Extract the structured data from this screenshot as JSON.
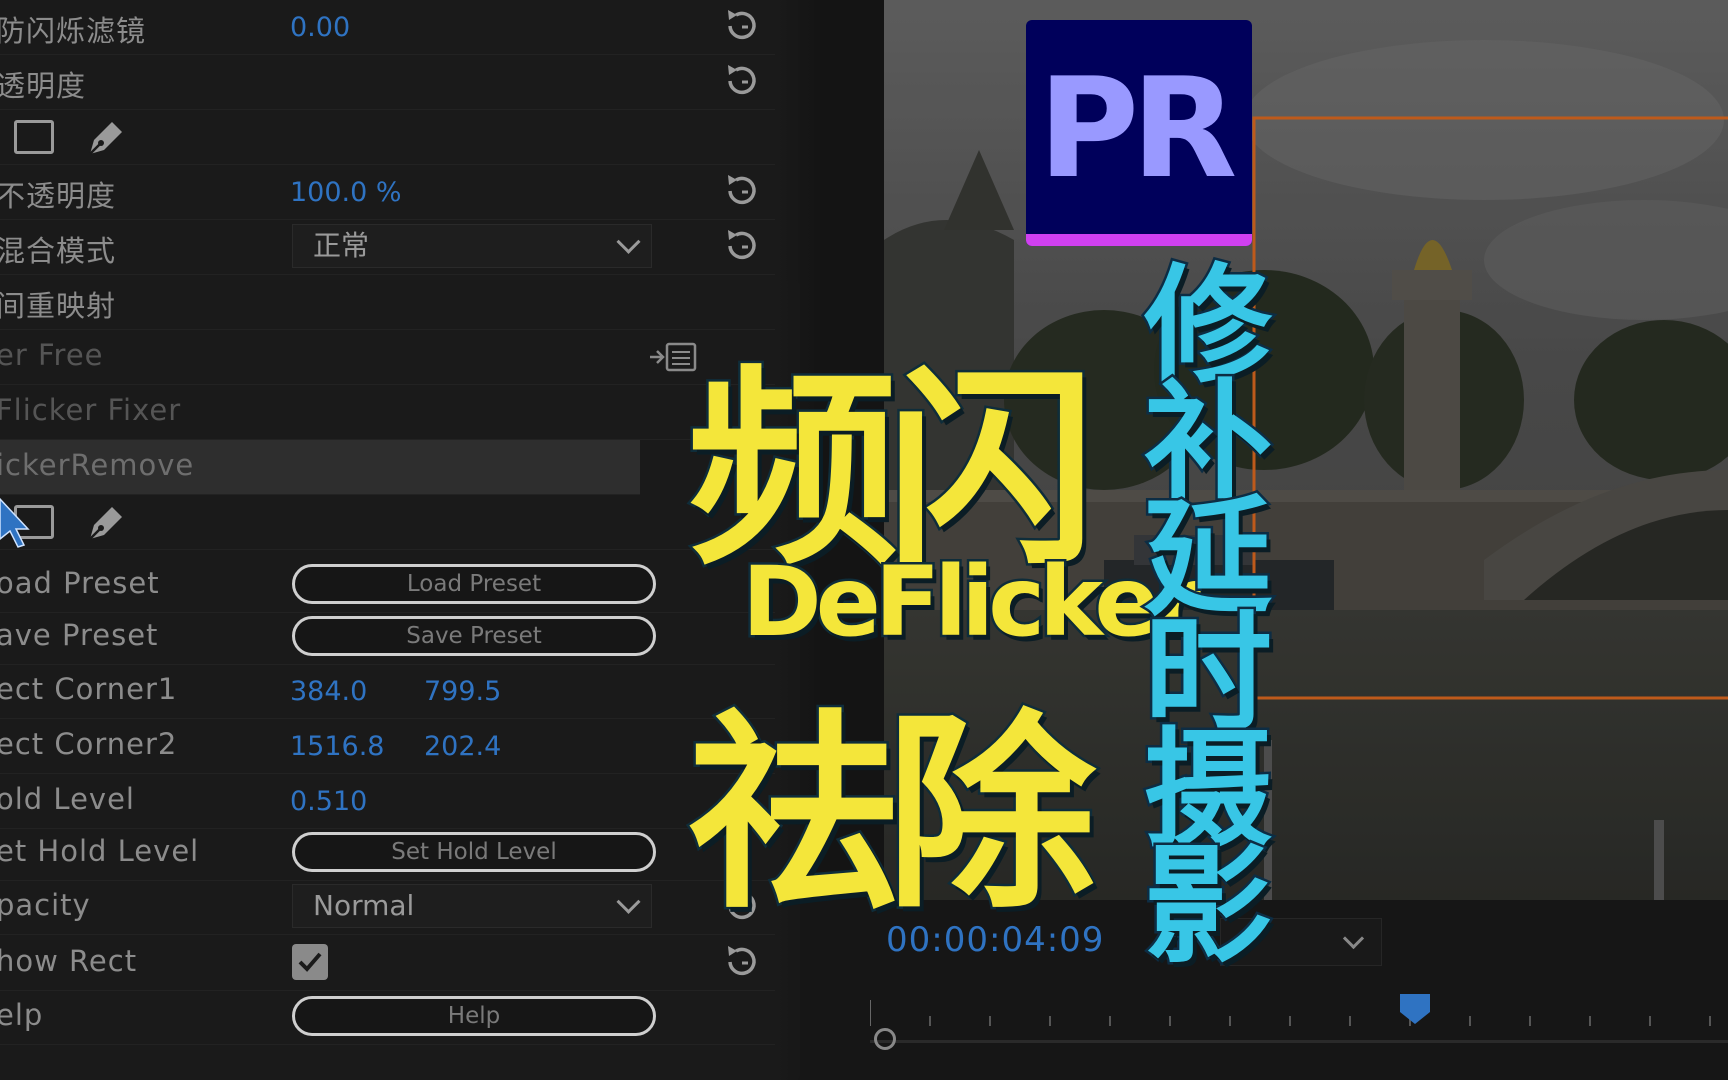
{
  "effect_controls": {
    "rows": [
      {
        "label": "防闪烁滤镜",
        "value": "0.00"
      },
      {
        "label": "透明度"
      },
      {
        "label": "不透明度",
        "value": "100.0 %"
      },
      {
        "label": "混合模式",
        "dropdown": "正常"
      },
      {
        "label": "间重映射"
      },
      {
        "label": "er Free"
      },
      {
        "label": "Flicker Fixer"
      },
      {
        "label": "ickerRemove"
      },
      {
        "label": "oad Preset",
        "button": "Load Preset"
      },
      {
        "label": "ave Preset",
        "button": "Save Preset"
      },
      {
        "label": "ect Corner1",
        "x": "384.0",
        "y": "799.5"
      },
      {
        "label": "ect Corner2",
        "x": "1516.8",
        "y": "202.4"
      },
      {
        "label": "old Level",
        "value": "0.510"
      },
      {
        "label": "et Hold Level",
        "button": "Set Hold Level"
      },
      {
        "label": "pacity",
        "dropdown": "Normal"
      },
      {
        "label": "how Rect",
        "checked": true
      },
      {
        "label": "elp",
        "button": "Help"
      }
    ]
  },
  "monitor": {
    "timecode": "00:00:04:09"
  },
  "overlay": {
    "logo_text": "PR",
    "title_line1": "频闪",
    "title_line2": "DeFlicker",
    "title_line3": "祛除",
    "vertical_title": [
      "修",
      "补",
      "延",
      "时",
      "摄",
      "影"
    ]
  },
  "colors": {
    "accent_blue": "#2f73c2",
    "title_yellow": "#f4e63a",
    "title_cyan": "#38c6e6",
    "pr_bg": "#00005b",
    "pr_text": "#9999ff",
    "pr_bar": "#d040f0",
    "rect_orange": "#e06a20"
  }
}
